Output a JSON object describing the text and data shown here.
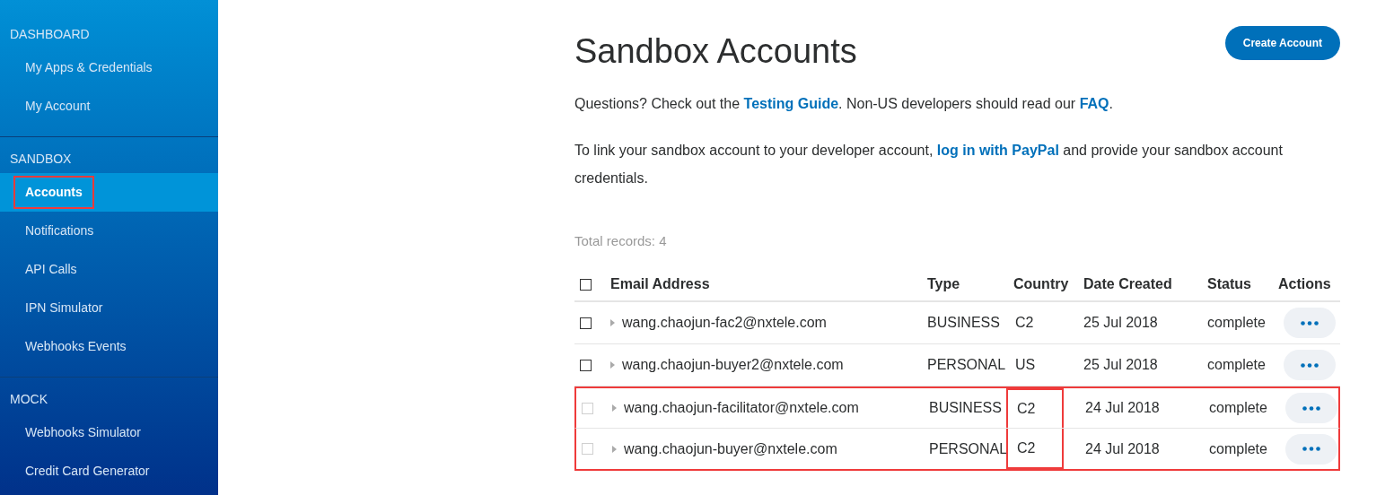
{
  "sidebar": {
    "sections": [
      {
        "title": "DASHBOARD",
        "items": [
          {
            "label": "My Apps & Credentials",
            "selected": false,
            "annotated": false
          },
          {
            "label": "My Account",
            "selected": false,
            "annotated": false
          }
        ]
      },
      {
        "title": "SANDBOX",
        "items": [
          {
            "label": "Accounts",
            "selected": true,
            "annotated": true
          },
          {
            "label": "Notifications",
            "selected": false,
            "annotated": false
          },
          {
            "label": "API Calls",
            "selected": false,
            "annotated": false
          },
          {
            "label": "IPN Simulator",
            "selected": false,
            "annotated": false
          },
          {
            "label": "Webhooks Events",
            "selected": false,
            "annotated": false
          }
        ]
      },
      {
        "title": "MOCK",
        "items": [
          {
            "label": "Webhooks Simulator",
            "selected": false,
            "annotated": false
          },
          {
            "label": "Credit Card Generator",
            "selected": false,
            "annotated": false
          }
        ]
      }
    ]
  },
  "page": {
    "title": "Sandbox Accounts",
    "create_button": "Create Account",
    "paragraphs": [
      [
        {
          "text": "Questions? Check out the ",
          "link": false
        },
        {
          "text": "Testing Guide",
          "link": true
        },
        {
          "text": ". Non-US developers should read our ",
          "link": false
        },
        {
          "text": "FAQ",
          "link": true
        },
        {
          "text": ".",
          "link": false
        }
      ],
      [
        {
          "text": "To link your sandbox account to your developer account, ",
          "link": false
        },
        {
          "text": "log in with PayPal",
          "link": true
        },
        {
          "text": " and provide your sandbox account credentials.",
          "link": false
        }
      ]
    ],
    "total": "Total records: 4"
  },
  "table": {
    "select_all_checked": false,
    "columns": [
      "Email Address",
      "Type",
      "Country",
      "Date Created",
      "Status",
      "Actions"
    ],
    "rows": [
      {
        "checked": false,
        "disabled": false,
        "annotated": false,
        "country_annotated": false,
        "email": "wang.chaojun-fac2@nxtele.com",
        "type": "BUSINESS",
        "country": "C2",
        "date": "25 Jul 2018",
        "status": "complete"
      },
      {
        "checked": false,
        "disabled": false,
        "annotated": false,
        "country_annotated": false,
        "email": "wang.chaojun-buyer2@nxtele.com",
        "type": "PERSONAL",
        "country": "US",
        "date": "25 Jul 2018",
        "status": "complete"
      },
      {
        "checked": false,
        "disabled": true,
        "annotated": true,
        "country_annotated": true,
        "email": "wang.chaojun-facilitator@nxtele.com",
        "type": "BUSINESS",
        "country": "C2",
        "date": "24 Jul 2018",
        "status": "complete"
      },
      {
        "checked": false,
        "disabled": true,
        "annotated": true,
        "country_annotated": true,
        "email": "wang.chaojun-buyer@nxtele.com",
        "type": "PERSONAL",
        "country": "C2",
        "date": "24 Jul 2018",
        "status": "complete"
      }
    ]
  }
}
